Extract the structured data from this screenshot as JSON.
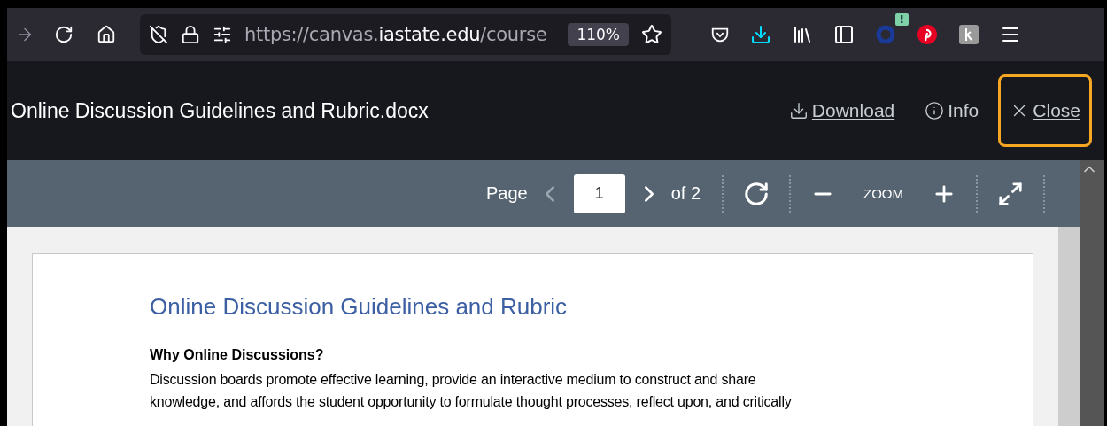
{
  "browser": {
    "url_scheme_prefix": "https://canvas.",
    "url_host": "iastate.edu",
    "url_path": "/course",
    "zoom": "110%",
    "extension_badge": "!"
  },
  "viewer": {
    "file_title": "Online Discussion Guidelines and Rubric.docx",
    "actions": [
      {
        "kind": "download",
        "label": "Download",
        "focused": false
      },
      {
        "kind": "info",
        "label": "Info",
        "focused": false
      },
      {
        "kind": "close",
        "label": "Close",
        "focused": true
      }
    ]
  },
  "toolbar": {
    "page_label": "Page",
    "page_value": "1",
    "page_total": "of 2",
    "zoom_label": "ZOOM"
  },
  "document": {
    "title": "Online Discussion Guidelines and Rubric",
    "heading": "Why Online Discussions?",
    "paragraph_lines": [
      "Discussion boards promote effective learning, provide an interactive medium to construct and share",
      "knowledge, and affords the student opportunity to formulate thought processes, reflect upon, and critically"
    ]
  }
}
